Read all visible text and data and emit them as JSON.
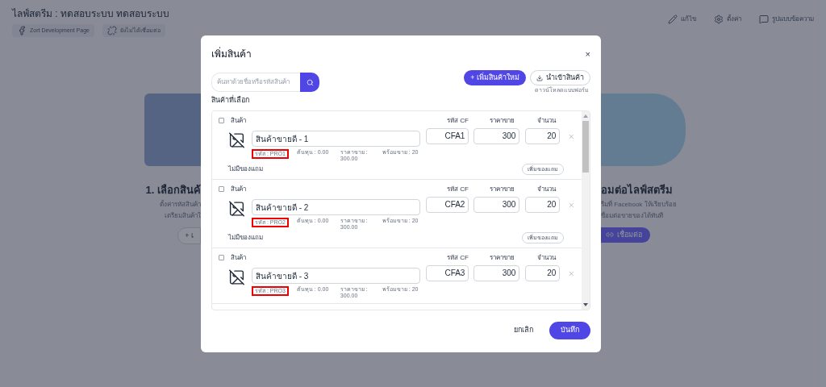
{
  "page": {
    "title": "ไลฟ์สตรีม : ทดสอบระบบ ทดสอบระบบ",
    "chips": [
      {
        "kind": "facebook",
        "label": "Zort Development Page"
      },
      {
        "kind": "unlinked",
        "label": "ยังไม่ได้เชื่อมต่อ"
      }
    ],
    "actions": [
      {
        "kind": "edit",
        "label": "แก้ไข"
      },
      {
        "kind": "settings",
        "label": "ตั้งค่า"
      },
      {
        "kind": "message",
        "label": "รูปแบบข้อความ"
      }
    ],
    "left_step": {
      "title": "1. เลือกสินค้",
      "lines": [
        "ตั้งค่ารหัสสินค้า",
        "เตรียมสินค้าใ"
      ],
      "button": "+ เ"
    },
    "right_step": {
      "title": "อมต่อไลฟ์สตรีม",
      "lines": [
        "รีมที่ Facebook ให้เรียบร้อย",
        "ชื่อมต่อขายของได้ทันที"
      ],
      "button": "เชื่อมต่อ"
    }
  },
  "dialog": {
    "title": "เพิ่มสินค้า",
    "close": "×",
    "search": {
      "placeholder": "ค้นหาด้วยชื่อหรือรหัสสินค้า"
    },
    "add_button": "+ เพิ่มสินค้าใหม่",
    "import_button": "นำเข้าสินค้า",
    "download_link": "ดาวน์โหลดแบบฟอร์ม",
    "section_label": "สินค้าที่เลือก",
    "items": [
      {
        "checked": false,
        "header": "สินค้า",
        "col_cf": "รหัส CF",
        "col_price": "ราคาขาย",
        "col_qty": "จำนวน",
        "name": "สินค้าขายดี - 1",
        "cf": "CFA1",
        "price": "300",
        "qty": "20",
        "code": "รหัส : PRO1",
        "code_highlighted": true,
        "cost": "ต้นทุน : 0.00",
        "sell": "ราคาขาย : 300.00",
        "ready": "พร้อมขาย : 20",
        "gift_label": "ไม่มีของแถม",
        "gift_button": "เพิ่มของแถม"
      },
      {
        "checked": false,
        "header": "สินค้า",
        "col_cf": "รหัส CF",
        "col_price": "ราคาขาย",
        "col_qty": "จำนวน",
        "name": "สินค้าขายดี - 2",
        "cf": "CFA2",
        "price": "300",
        "qty": "20",
        "code": "รหัส : PRO2",
        "code_highlighted": true,
        "cost": "ต้นทุน : 0.00",
        "sell": "ราคาขาย : 300.00",
        "ready": "พร้อมขาย : 20",
        "gift_label": "ไม่มีของแถม",
        "gift_button": "เพิ่มของแถม"
      },
      {
        "checked": false,
        "header": "สินค้า",
        "col_cf": "รหัส CF",
        "col_price": "ราคาขาย",
        "col_qty": "จำนวน",
        "name": "สินค้าขายดี - 3",
        "cf": "CFA3",
        "price": "300",
        "qty": "20",
        "code": "รหัส : PRO3",
        "code_highlighted": true,
        "cost": "ต้นทุน : 0.00",
        "sell": "ราคาขาย : 300.00",
        "ready": "พร้อมขาย : 20"
      }
    ],
    "cancel": "ยกเลิก",
    "save": "บันทึก"
  }
}
